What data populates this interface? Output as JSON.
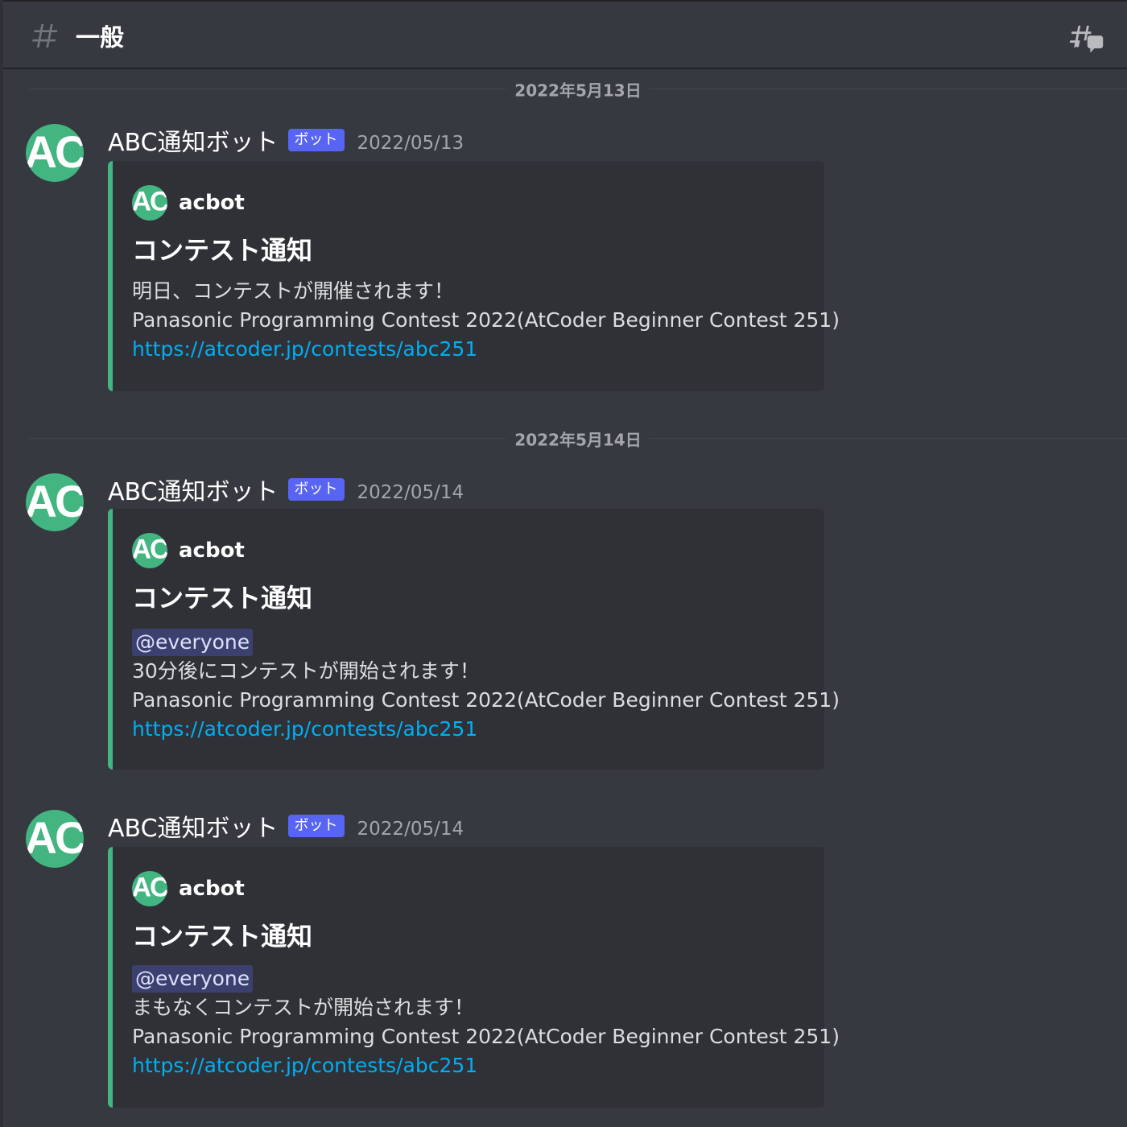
{
  "header": {
    "channel_name": "一般",
    "hash_icon": "hash-icon",
    "threads_icon": "threads-icon"
  },
  "dividers": [
    {
      "label": "2022年5月13日"
    },
    {
      "label": "2022年5月14日"
    }
  ],
  "messages": [
    {
      "author": "ABC通知ボット",
      "bot_tag": "ボット",
      "timestamp": "2022/05/13",
      "avatar_text": "AC",
      "embed": {
        "author_avatar_text": "AC",
        "author_name": "acbot",
        "title": "コンテスト通知",
        "mention": "",
        "line1": "明日、コンテストが開催されます！",
        "line2": "Panasonic Programming Contest 2022(AtCoder Beginner Contest 251)",
        "link": "https://atcoder.jp/contests/abc251"
      }
    },
    {
      "author": "ABC通知ボット",
      "bot_tag": "ボット",
      "timestamp": "2022/05/14",
      "avatar_text": "AC",
      "embed": {
        "author_avatar_text": "AC",
        "author_name": "acbot",
        "title": "コンテスト通知",
        "mention": "@everyone",
        "line1": "30分後にコンテストが開始されます！",
        "line2": "Panasonic Programming Contest 2022(AtCoder Beginner Contest 251)",
        "link": "https://atcoder.jp/contests/abc251"
      }
    },
    {
      "author": "ABC通知ボット",
      "bot_tag": "ボット",
      "timestamp": "2022/05/14",
      "avatar_text": "AC",
      "embed": {
        "author_avatar_text": "AC",
        "author_name": "acbot",
        "title": "コンテスト通知",
        "mention": "@everyone",
        "line1": "まもなくコンテストが開始されます！",
        "line2": "Panasonic Programming Contest 2022(AtCoder Beginner Contest 251)",
        "link": "https://atcoder.jp/contests/abc251"
      }
    }
  ],
  "colors": {
    "background": "#36393f",
    "embed_background": "#2f3136",
    "embed_accent": "#43b581",
    "bot_tag": "#5865f2",
    "link": "#00aff4"
  }
}
